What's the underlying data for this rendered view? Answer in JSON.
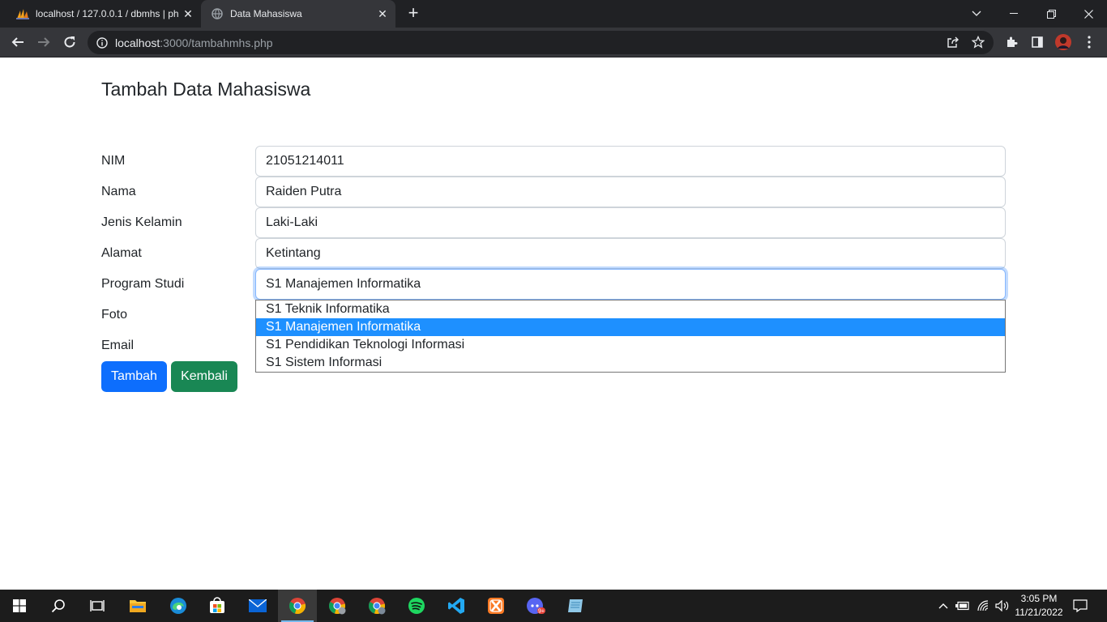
{
  "browser": {
    "tabs": [
      {
        "title": "localhost / 127.0.0.1 / dbmhs | ph",
        "active": false
      },
      {
        "title": "Data Mahasiswa",
        "active": true
      }
    ],
    "url_host": "localhost",
    "url_path": ":3000/tambahmhs.php"
  },
  "page": {
    "title": "Tambah Data Mahasiswa",
    "fields": [
      {
        "label": "NIM",
        "value": "21051214011"
      },
      {
        "label": "Nama",
        "value": "Raiden Putra"
      },
      {
        "label": "Jenis Kelamin",
        "value": "Laki-Laki"
      },
      {
        "label": "Alamat",
        "value": "Ketintang"
      },
      {
        "label": "Program Studi",
        "value": "S1 Manajemen Informatika"
      },
      {
        "label": "Foto",
        "value": ""
      },
      {
        "label": "Email",
        "value": ""
      }
    ],
    "prodi_options": [
      "S1 Teknik Informatika",
      "S1 Manajemen Informatika",
      "S1 Pendidikan Teknologi Informasi",
      "S1 Sistem Informasi"
    ],
    "prodi_selected": "S1 Manajemen Informatika",
    "buttons": {
      "submit": "Tambah",
      "back": "Kembali"
    },
    "colors": {
      "primary": "#0d6efd",
      "success": "#198754",
      "option_highlight": "#1e90ff"
    }
  },
  "taskbar": {
    "apps": [
      "start-icon",
      "search-icon",
      "task-view-icon",
      "file-explorer-icon",
      "edge-icon",
      "store-icon",
      "mail-icon",
      "chrome-icon",
      "chrome-profile-icon",
      "chrome-profile-icon",
      "spotify-icon",
      "vscode-icon",
      "xampp-icon",
      "discord-icon",
      "notepad-icon"
    ],
    "time": "3:05 PM",
    "date": "11/21/2022"
  }
}
